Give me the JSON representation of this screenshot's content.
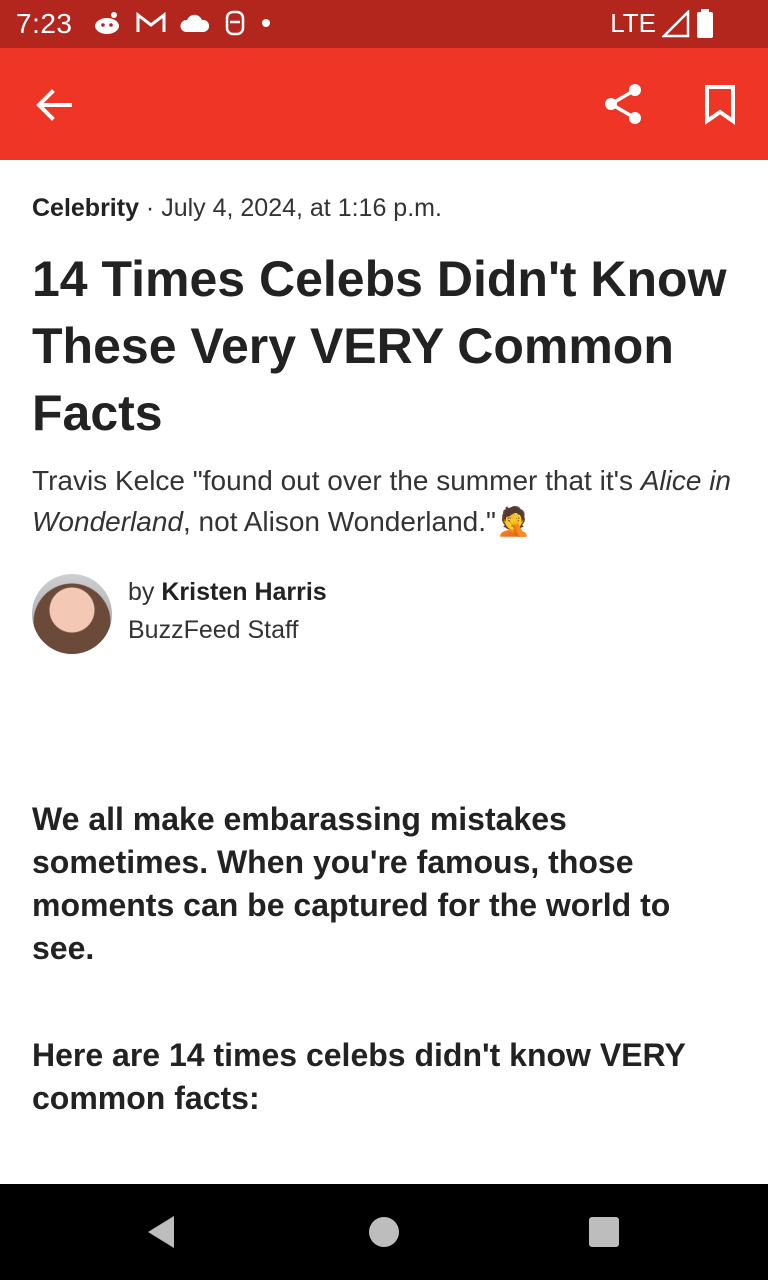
{
  "status_bar": {
    "time": "7:23",
    "network": "LTE",
    "notification_icons": [
      "reddit-icon",
      "gmail-icon",
      "cloud-icon",
      "app-icon",
      "dot-icon"
    ]
  },
  "app_bar": {
    "back_icon": "arrow-back-icon",
    "share_icon": "share-icon",
    "bookmark_icon": "bookmark-icon",
    "color": "#ef3526"
  },
  "article": {
    "category": "Celebrity",
    "date": " · July 4, 2024, at 1:16 p.m.",
    "headline": "14 Times Celebs Didn't Know These Very VERY Common Facts",
    "subhead_part1": "Travis Kelce \"found out over the summer that it's ",
    "subhead_italic": "Alice in Wonderland",
    "subhead_part2": ", not Alison Wonderland.\"",
    "subhead_emoji": "🤦",
    "byline_prefix": "by ",
    "author": "Kristen Harris",
    "author_role": "BuzzFeed Staff",
    "lead": "We all make embarassing mistakes sometimes. When you're famous, those moments can be captured for the world to see.",
    "lead2": "Here are 14 times celebs didn't know VERY common facts:"
  },
  "colors": {
    "status_bar": "#b3261e",
    "app_bar": "#ef3526",
    "nav_bar": "#000000"
  }
}
